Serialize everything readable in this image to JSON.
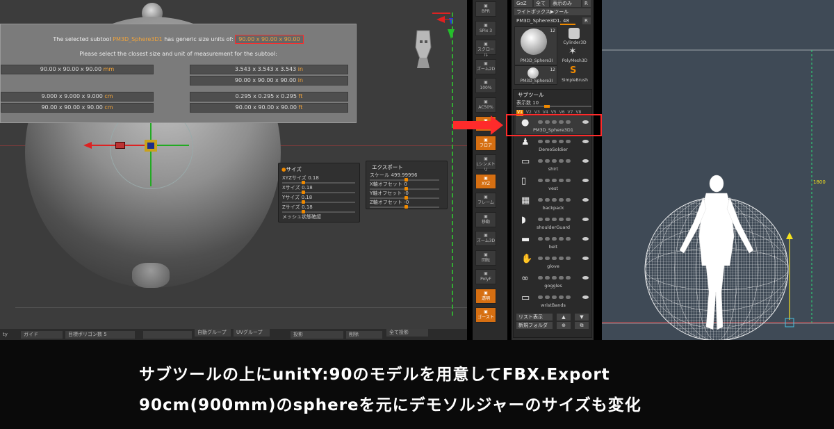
{
  "dialog": {
    "line1_prefix": "The selected subtool",
    "line1_tool": "PM3D_Sphere3D1",
    "line1_mid": "has generic size units of:",
    "line1_units": "90.00 x 90.00 x 90.00",
    "line2": "Please select the closest size and unit of measurement for the subtool:",
    "options": [
      {
        "value": "90.00 x 90.00 x 90.00",
        "unit": "mm"
      },
      {
        "value": "3.543 x 3.543 x 3.543",
        "unit": "in"
      },
      {
        "value": "90.00 x 90.00 x 90.00",
        "unit": "in"
      },
      {
        "value": "9.000 x 9.000 x 9.000",
        "unit": "cm"
      },
      {
        "value": "0.295 x 0.295 x 0.295",
        "unit": "ft"
      },
      {
        "value": "90.00 x 90.00 x 90.00",
        "unit": "cm"
      },
      {
        "value": "90.00 x 90.00 x 90.00",
        "unit": "ft"
      }
    ]
  },
  "size_panel": {
    "title": "サイズ",
    "rows": [
      {
        "label": "XYZサイズ",
        "value": "0.18",
        "level": 0.18
      },
      {
        "label": "Xサイズ",
        "value": "0.18",
        "level": 0.18
      },
      {
        "label": "Yサイズ",
        "value": "0.18",
        "level": 0.18
      },
      {
        "label": "Zサイズ",
        "value": "0.18",
        "level": 0.18
      }
    ],
    "mesh_check": "メッシュ状態確認"
  },
  "export_panel": {
    "title": "エクスポート",
    "rows": [
      {
        "label": "スケール",
        "value": "499.99996",
        "level": 0.5
      },
      {
        "label": "X軸オフセット",
        "value": "0",
        "level": 0.5
      },
      {
        "label": "Y軸オフセット",
        "value": "-0",
        "level": 0.5
      },
      {
        "label": "Z軸オフセット",
        "value": "-0",
        "level": 0.5
      }
    ]
  },
  "bottom_bar": {
    "target_polys": "目標ポリゴン数 5",
    "auto_group": "自動グループ",
    "uv_group": "UVグループ",
    "all_projection": "全て投影",
    "guide": "ガイド",
    "projection": "投影",
    "delete": "削除",
    "ty": "ty"
  },
  "shelf": {
    "buttons": [
      {
        "label": "BPR",
        "active": false
      },
      {
        "label": "SPix 3",
        "active": false
      },
      {
        "label": "スクロール",
        "active": false
      },
      {
        "label": "ズーム2D",
        "active": false
      },
      {
        "label": "100%",
        "active": false
      },
      {
        "label": "AC50%",
        "active": false
      },
      {
        "label": "パース",
        "active": true
      },
      {
        "label": "フロア",
        "active": true
      },
      {
        "label": "Lシンメトリ",
        "active": false
      },
      {
        "label": "XYZ",
        "active": true
      },
      {
        "label": "フレーム",
        "active": false
      },
      {
        "label": "移動",
        "active": false
      },
      {
        "label": "ズーム3D",
        "active": false
      },
      {
        "label": "回転",
        "active": false
      },
      {
        "label": "PolyF",
        "active": false
      },
      {
        "label": "透明",
        "active": true
      },
      {
        "label": "ゴースト",
        "active": true
      }
    ]
  },
  "tool_panel": {
    "top_buttons": [
      "GoZ",
      "全て",
      "表示のみ",
      "R"
    ],
    "lightbox": "ライトボックス▶ツール",
    "current_tool": "PM3D_Sphere3D1. 48",
    "r_button": "R",
    "thumbs": [
      {
        "label": "PM3D_Sphere3I",
        "badge": "12"
      },
      {
        "label": "Cylinder3D",
        "badge": ""
      },
      {
        "label": "PolyMesh3D",
        "badge": ""
      },
      {
        "label": "PM3D_Sphere3I",
        "badge": "12"
      },
      {
        "label": "SimpleBrush",
        "badge": ""
      }
    ],
    "subtool_title": "サブツール",
    "visible_count": "表示数 10",
    "versions": [
      "V1",
      "V2",
      "V3",
      "V4",
      "V5",
      "V6",
      "V7",
      "V8"
    ],
    "subtools": [
      "PM3D_Sphere3D1",
      "DemoSoldier",
      "shirt",
      "vest",
      "backpack",
      "shoulderGuard",
      "belt",
      "glove",
      "goggles",
      "wristBands"
    ],
    "list_view": "リスト表示",
    "new_folder": "新規フォルダ"
  },
  "right_view": {
    "dimension_label": "1800",
    "color_wire": "#ffffff",
    "color_axis_y": "#2be07a",
    "color_arrow": "#f5e21e"
  },
  "caption": {
    "line1": "サブツールの上にunitY:90のモデルを用意してFBX.Export",
    "line2": "90cm(900mm)のsphereを元にデモソルジャーのサイズも変化"
  },
  "colors": {
    "accent": "#f08a00",
    "highlight_red": "#ff2b2b"
  }
}
